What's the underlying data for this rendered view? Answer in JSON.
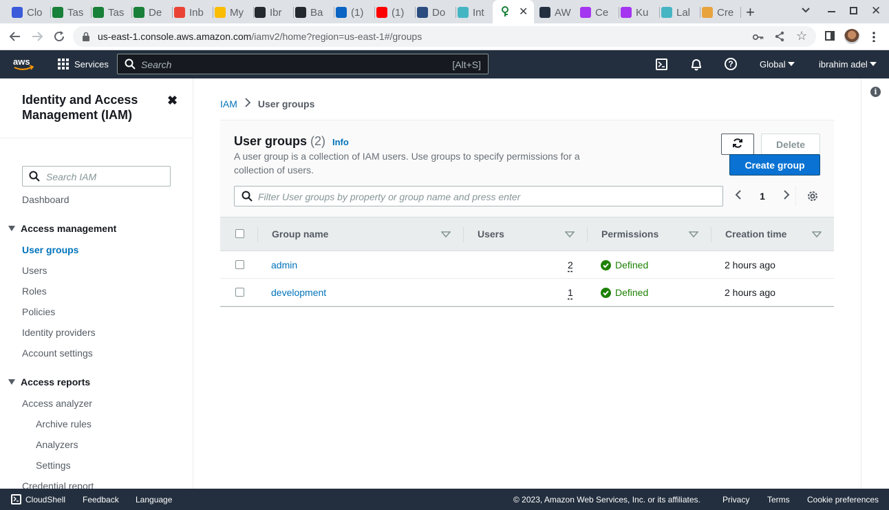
{
  "browser": {
    "tabs": [
      {
        "label": "Clo",
        "icon": "app-icon",
        "color": "#3b5bdb"
      },
      {
        "label": "Tas",
        "icon": "sheets-icon",
        "color": "#188038"
      },
      {
        "label": "Tas",
        "icon": "sheets-icon",
        "color": "#188038"
      },
      {
        "label": "De",
        "icon": "sheets-icon",
        "color": "#188038"
      },
      {
        "label": "Inb",
        "icon": "gmail-icon",
        "color": "#ea4335"
      },
      {
        "label": "My",
        "icon": "drive-icon",
        "color": "#fbbc04"
      },
      {
        "label": "Ibr",
        "icon": "github-icon",
        "color": "#24292f"
      },
      {
        "label": "Ba",
        "icon": "github-icon",
        "color": "#24292f"
      },
      {
        "label": "(1)",
        "icon": "linkedin-icon",
        "color": "#0a66c2"
      },
      {
        "label": "(1)",
        "icon": "youtube-icon",
        "color": "#ff0000"
      },
      {
        "label": "Do",
        "icon": "docker-icon",
        "color": "#2b4c7e"
      },
      {
        "label": "Int",
        "icon": "cloud-icon",
        "color": "#45b5c4"
      },
      {
        "label": "AW",
        "icon": "aws-icon",
        "color": "#232f3e"
      },
      {
        "label": "Ce",
        "icon": "udemy-icon",
        "color": "#a435f0"
      },
      {
        "label": "Ku",
        "icon": "udemy-icon",
        "color": "#a435f0"
      },
      {
        "label": "Lal",
        "icon": "cloud-icon",
        "color": "#45b5c4"
      },
      {
        "label": "Cre",
        "icon": "box-icon",
        "color": "#e8a33d"
      }
    ],
    "url_host": "us-east-1.console.aws.amazon.com",
    "url_path": "/iamv2/home?region=us-east-1#/groups"
  },
  "awsnav": {
    "services_label": "Services",
    "search_placeholder": "Search",
    "search_shortcut": "[Alt+S]",
    "region_label": "Global",
    "user_label": "ibrahim adel"
  },
  "sidebar": {
    "title": "Identity and Access Management (IAM)",
    "search_placeholder": "Search IAM",
    "dashboard": "Dashboard",
    "access_management": {
      "heading": "Access management",
      "items": [
        "User groups",
        "Users",
        "Roles",
        "Policies",
        "Identity providers",
        "Account settings"
      ]
    },
    "access_reports": {
      "heading": "Access reports",
      "analyzer": "Access analyzer",
      "sub_items": [
        "Archive rules",
        "Analyzers",
        "Settings"
      ],
      "credential_report": "Credential report"
    }
  },
  "breadcrumb": {
    "root": "IAM",
    "current": "User groups"
  },
  "panel": {
    "title": "User groups",
    "count": "(2)",
    "info": "Info",
    "description": "A user group is a collection of IAM users. Use groups to specify permissions for a collection of users.",
    "delete_label": "Delete",
    "create_label": "Create group",
    "filter_placeholder": "Filter User groups by property or group name and press enter",
    "page": "1"
  },
  "table": {
    "columns": [
      "Group name",
      "Users",
      "Permissions",
      "Creation time"
    ],
    "rows": [
      {
        "name": "admin",
        "users": "2",
        "permissions": "Defined",
        "created": "2 hours ago"
      },
      {
        "name": "development",
        "users": "1",
        "permissions": "Defined",
        "created": "2 hours ago"
      }
    ]
  },
  "footer": {
    "cloudshell": "CloudShell",
    "feedback": "Feedback",
    "language": "Language",
    "copyright": "© 2023, Amazon Web Services, Inc. or its affiliates.",
    "privacy": "Privacy",
    "terms": "Terms",
    "cookies": "Cookie preferences"
  },
  "colors": {
    "accent": "#0073bb",
    "primary_button": "#0972d3",
    "success": "#1d8102",
    "nav_bg": "#232f3e"
  }
}
